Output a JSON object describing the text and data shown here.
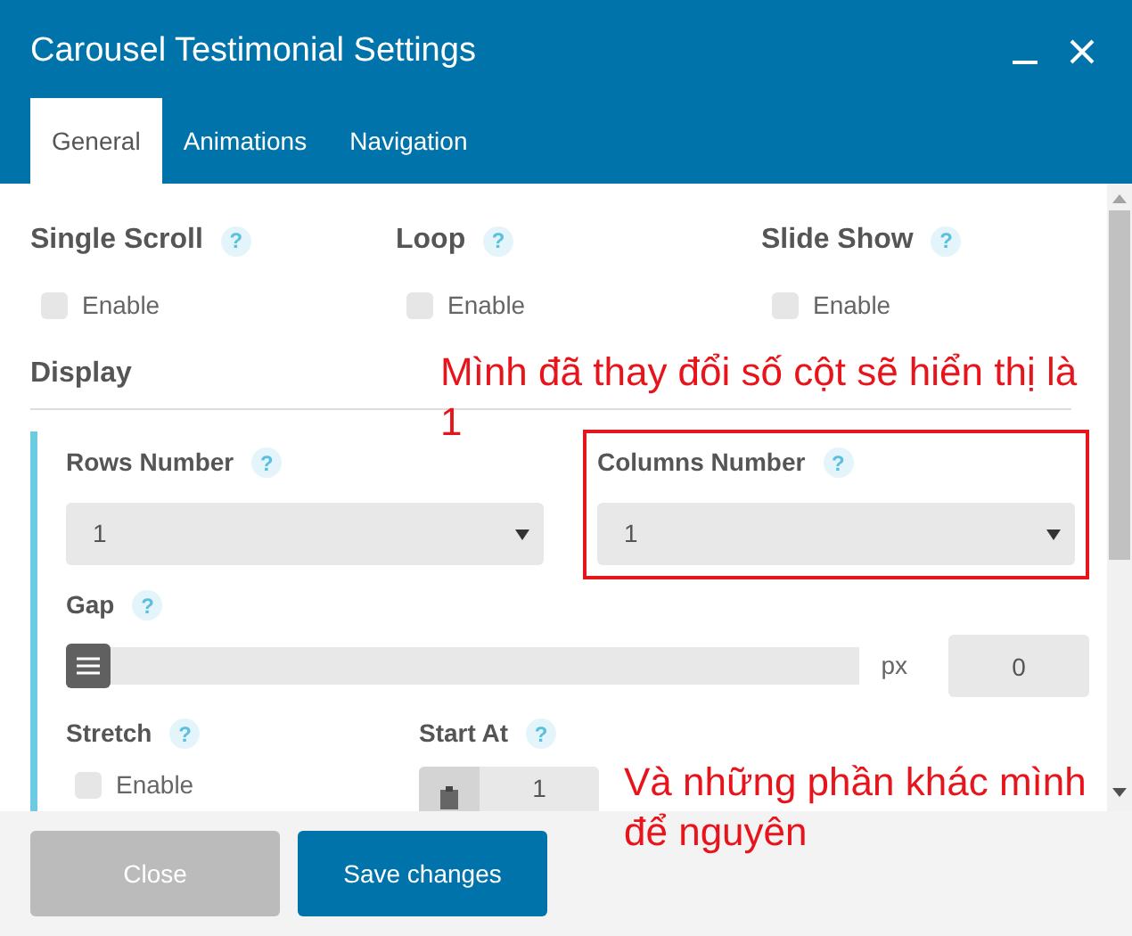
{
  "window": {
    "title": "Carousel Testimonial Settings"
  },
  "tabs": [
    {
      "label": "General",
      "selected": true
    },
    {
      "label": "Animations",
      "selected": false
    },
    {
      "label": "Navigation",
      "selected": false
    }
  ],
  "toggles": [
    {
      "label": "Single Scroll",
      "help": "?",
      "option": "Enable",
      "checked": false
    },
    {
      "label": "Loop",
      "help": "?",
      "option": "Enable",
      "checked": false
    },
    {
      "label": "Slide Show",
      "help": "?",
      "option": "Enable",
      "checked": false
    }
  ],
  "display": {
    "heading": "Display",
    "rows_number": {
      "label": "Rows Number",
      "help": "?",
      "value": "1"
    },
    "columns_number": {
      "label": "Columns Number",
      "help": "?",
      "value": "1",
      "highlighted": true
    },
    "gap": {
      "label": "Gap",
      "help": "?",
      "level": 0,
      "unit": "px",
      "value": "0"
    },
    "stretch": {
      "label": "Stretch",
      "help": "?",
      "option": "Enable",
      "checked": false
    },
    "start_at": {
      "label": "Start At",
      "help": "?",
      "value": "1"
    }
  },
  "buttons": [
    {
      "label": "Close",
      "kind": "secondary"
    },
    {
      "label": "Save changes",
      "kind": "primary"
    }
  ],
  "annotations": [
    {
      "text": "Mình đã thay đổi số cột sẽ hiển thị là 1"
    },
    {
      "text": "Và những phần khác mình để nguyên"
    }
  ]
}
